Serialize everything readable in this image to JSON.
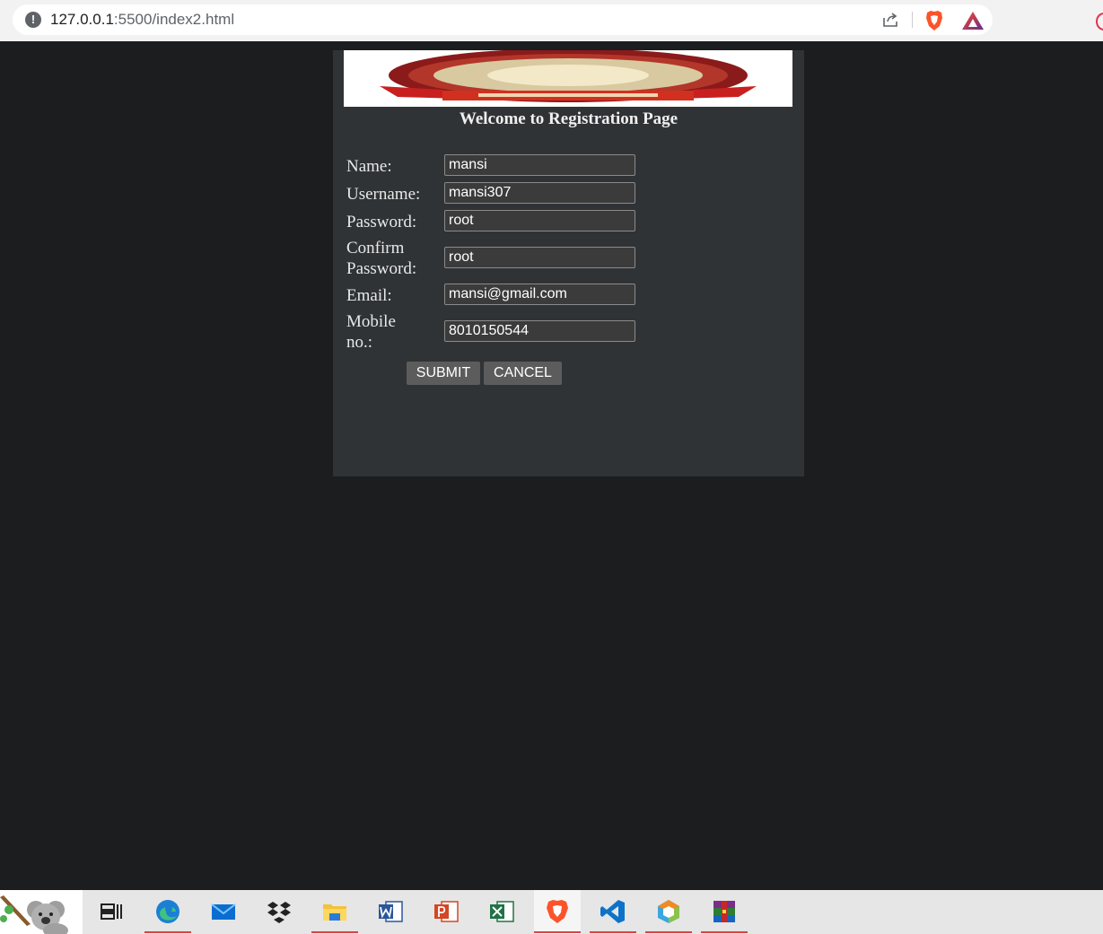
{
  "browser": {
    "url_host": "127.0.0.1",
    "url_path": ":5500/index2.html"
  },
  "page": {
    "heading": "Welcome to Registration Page"
  },
  "form": {
    "name": {
      "label": "Name:",
      "value": "mansi"
    },
    "username": {
      "label": "Username:",
      "value": "mansi307"
    },
    "password": {
      "label": "Password:",
      "value": "root"
    },
    "confirm_password": {
      "label_line1": "Confirm",
      "label_line2": "Password:",
      "value": "root"
    },
    "email": {
      "label": "Email:",
      "value": "mansi@gmail.com"
    },
    "mobile": {
      "label_line1": "Mobile",
      "label_line2": "no.:",
      "value": "8010150544"
    },
    "submit_label": "SUBMIT",
    "cancel_label": "CANCEL"
  },
  "colors": {
    "page_background": "#1c1d1f",
    "panel_background": "#303336",
    "input_background": "#3b3b3b",
    "button_background": "#5c5c5c",
    "taskbar_running_indicator": "#d64545"
  },
  "taskbar": {
    "items": [
      {
        "icon": "koala-icon",
        "running": false
      },
      {
        "icon": "task-view-icon",
        "running": false
      },
      {
        "icon": "edge-icon",
        "running": true
      },
      {
        "icon": "mail-icon",
        "running": false
      },
      {
        "icon": "dropbox-icon",
        "running": false
      },
      {
        "icon": "file-explorer-icon",
        "running": true
      },
      {
        "icon": "word-icon",
        "running": false
      },
      {
        "icon": "powerpoint-icon",
        "running": false
      },
      {
        "icon": "excel-icon",
        "running": false
      },
      {
        "icon": "brave-icon",
        "running": true
      },
      {
        "icon": "vscode-icon",
        "running": true
      },
      {
        "icon": "netbeans-icon",
        "running": true
      },
      {
        "icon": "winrar-icon",
        "running": true
      }
    ]
  }
}
